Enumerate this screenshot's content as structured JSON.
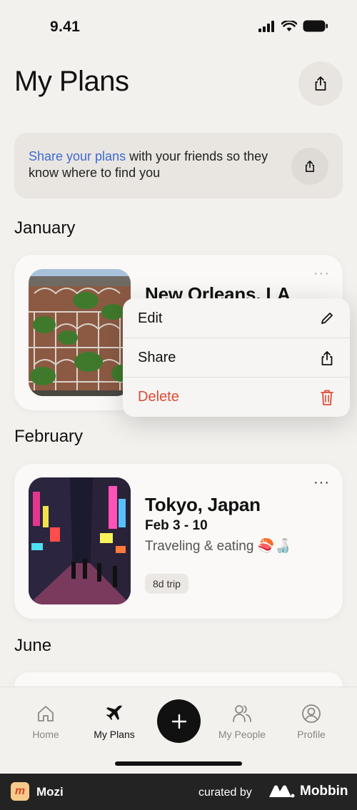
{
  "status_bar": {
    "time": "9.41"
  },
  "header": {
    "title": "My Plans"
  },
  "banner": {
    "link_text": "Share your plans",
    "rest_text": " with your friends so they know where to find you"
  },
  "sections": [
    {
      "month": "January"
    },
    {
      "month": "February"
    },
    {
      "month": "June"
    }
  ],
  "cards": [
    {
      "title": "New Orleans, LA",
      "more": "···"
    },
    {
      "title": "Tokyo, Japan",
      "dates": "Feb 3 - 10",
      "description": "Traveling & eating 🍣🍶",
      "badge": "8d trip",
      "more": "···"
    }
  ],
  "context_menu": {
    "items": [
      {
        "label": "Edit",
        "icon": "pencil-icon"
      },
      {
        "label": "Share",
        "icon": "share-icon"
      },
      {
        "label": "Delete",
        "icon": "trash-icon"
      }
    ]
  },
  "bottom_nav": {
    "items": [
      {
        "label": "Home",
        "icon": "home-icon"
      },
      {
        "label": "My Plans",
        "icon": "plane-icon"
      },
      {
        "label": "My People",
        "icon": "people-icon"
      },
      {
        "label": "Profile",
        "icon": "profile-icon"
      }
    ],
    "add_icon": "plus-icon"
  },
  "footer": {
    "app_name": "Mozi",
    "curated_by": "curated by",
    "brand": "Mobbin"
  },
  "colors": {
    "link": "#3f6ad0",
    "delete": "#e04a35",
    "background": "#f3f1ee"
  }
}
